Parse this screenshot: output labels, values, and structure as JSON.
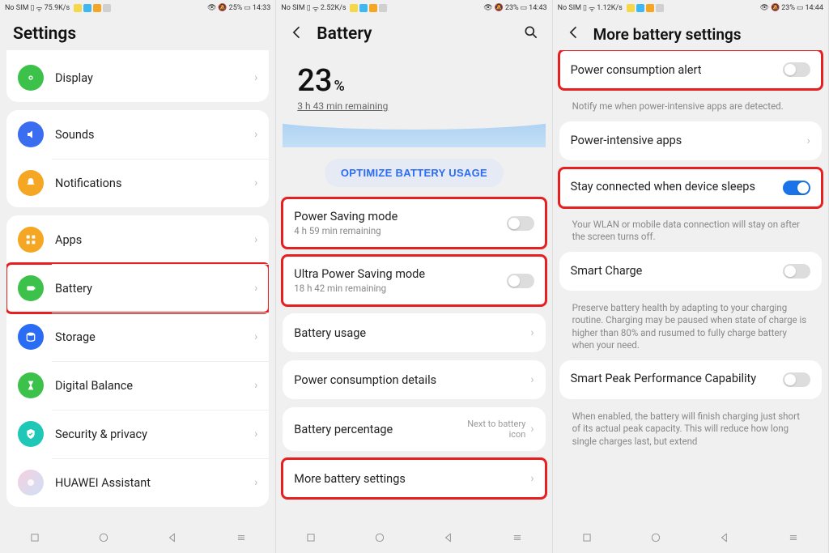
{
  "screen1": {
    "status": {
      "left": "No SIM",
      "rate": "75.9K/s",
      "batt": "25%",
      "time": "14:33"
    },
    "title": "Settings",
    "items": [
      {
        "label": "Display",
        "color": "#3cc24a",
        "icon": "eye"
      },
      {
        "label": "Sounds",
        "color": "#3b6df0",
        "icon": "sound"
      },
      {
        "label": "Notifications",
        "color": "#f5a623",
        "icon": "bell"
      },
      {
        "label": "Apps",
        "color": "#f5a623",
        "icon": "grid"
      },
      {
        "label": "Battery",
        "color": "#3cc24a",
        "icon": "battery",
        "highlight": true
      },
      {
        "label": "Storage",
        "color": "#2a6df4",
        "icon": "disk"
      },
      {
        "label": "Digital Balance",
        "color": "#3cc24a",
        "icon": "hourglass"
      },
      {
        "label": "Security & privacy",
        "color": "#1fc7b6",
        "icon": "shield"
      },
      {
        "label": "HUAWEI Assistant",
        "color": "#e8d0f0",
        "icon": "assist"
      }
    ]
  },
  "screen2": {
    "status": {
      "left": "No SIM",
      "rate": "2.52K/s",
      "batt": "23%",
      "time": "14:43"
    },
    "title": "Battery",
    "percent": "23",
    "remaining": "3 h 43 min remaining",
    "optimize": "OPTIMIZE BATTERY USAGE",
    "rows": [
      {
        "label": "Power Saving mode",
        "sub": "4 h 59 min remaining",
        "toggle": false,
        "highlight": true
      },
      {
        "label": "Ultra Power Saving mode",
        "sub": "18 h 42 min remaining",
        "toggle": false,
        "highlight": true
      },
      {
        "label": "Battery usage",
        "chev": true
      },
      {
        "label": "Power consumption details",
        "chev": true
      },
      {
        "label": "Battery percentage",
        "rtext": "Next to battery icon",
        "chev": true
      },
      {
        "label": "More battery settings",
        "chev": true,
        "highlight": true
      }
    ]
  },
  "screen3": {
    "status": {
      "left": "No SIM",
      "rate": "1.12K/s",
      "batt": "23%",
      "time": "14:44"
    },
    "title": "More battery settings",
    "rows": [
      {
        "label": "Power consumption alert",
        "toggle": false,
        "highlight": true,
        "help": "Notify me when power-intensive apps are detected."
      },
      {
        "label": "Power-intensive apps",
        "chev": true
      },
      {
        "label": "Stay connected when device sleeps",
        "toggle": true,
        "highlight": true,
        "help": "Your WLAN or mobile data connection will stay on after the screen turns off."
      },
      {
        "label": "Smart Charge",
        "toggle": false,
        "help": "Preserve battery health by adapting to your charging routine. Charging may be paused when state of charge is higher than 80% and rusumed to fully charge battery when your need."
      },
      {
        "label": "Smart Peak Performance Capability",
        "toggle": false,
        "help": "When enabled, the battery will finish charging just short of its actual peak capacity. This will reduce how long single charges last, but extend"
      }
    ]
  }
}
